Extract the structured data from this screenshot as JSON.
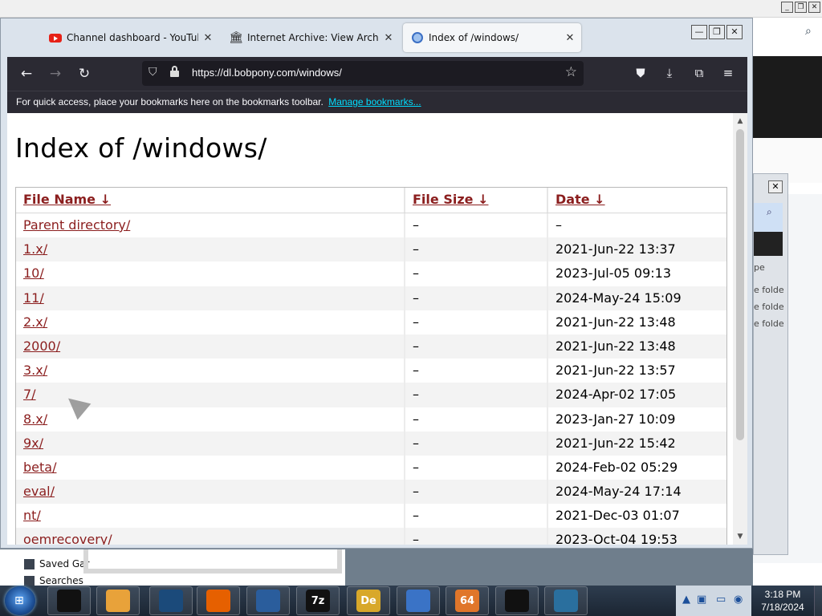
{
  "browser": {
    "tabs": [
      {
        "label": "Channel dashboard - YouTube",
        "icon": "youtube-icon",
        "active": false
      },
      {
        "label": "Internet Archive: View Archive",
        "icon": "internet-archive-icon",
        "active": false
      },
      {
        "label": "Index of /windows/",
        "icon": "globe-icon",
        "active": true
      }
    ],
    "url": "https://dl.bobpony.com/windows/",
    "bookmarks_text": "For quick access, place your bookmarks here on the bookmarks toolbar.",
    "bookmarks_link": "Manage bookmarks..."
  },
  "page": {
    "title": "Index of /windows/",
    "columns": [
      "File Name  ↓",
      "File Size  ↓",
      "Date  ↓"
    ],
    "entries": [
      {
        "name": "Parent directory/",
        "size": "–",
        "date": "–"
      },
      {
        "name": "1.x/",
        "size": "–",
        "date": "2021-Jun-22 13:37"
      },
      {
        "name": "10/",
        "size": "–",
        "date": "2023-Jul-05 09:13"
      },
      {
        "name": "11/",
        "size": "–",
        "date": "2024-May-24 15:09"
      },
      {
        "name": "2.x/",
        "size": "–",
        "date": "2021-Jun-22 13:48"
      },
      {
        "name": "2000/",
        "size": "–",
        "date": "2021-Jun-22 13:48"
      },
      {
        "name": "3.x/",
        "size": "–",
        "date": "2021-Jun-22 13:57"
      },
      {
        "name": "7/",
        "size": "–",
        "date": "2024-Apr-02 17:05"
      },
      {
        "name": "8.x/",
        "size": "–",
        "date": "2023-Jan-27 10:09"
      },
      {
        "name": "9x/",
        "size": "–",
        "date": "2021-Jun-22 15:42"
      },
      {
        "name": "beta/",
        "size": "–",
        "date": "2024-Feb-02 05:29"
      },
      {
        "name": "eval/",
        "size": "–",
        "date": "2024-May-24 17:14"
      },
      {
        "name": "nt/",
        "size": "–",
        "date": "2021-Dec-03 01:07"
      },
      {
        "name": "oemrecovery/",
        "size": "–",
        "date": "2023-Oct-04 19:53"
      }
    ]
  },
  "background": {
    "explorer_items": [
      "Saved Gar",
      "Searches"
    ],
    "side_window_text": [
      "pe",
      "e folde",
      "e folde",
      "e folde"
    ]
  },
  "taskbar": {
    "time": "3:18 PM",
    "date": "7/18/2024",
    "apps": [
      "cube-app",
      "media-player",
      "globe-app",
      "firefox",
      "virtualbox",
      "7z",
      "De",
      "network-app",
      "64",
      "terminal-app",
      "dolphin-app"
    ],
    "app_labels": [
      "",
      "",
      "",
      "",
      "",
      "7z",
      "De",
      "",
      "64",
      "",
      ""
    ]
  }
}
